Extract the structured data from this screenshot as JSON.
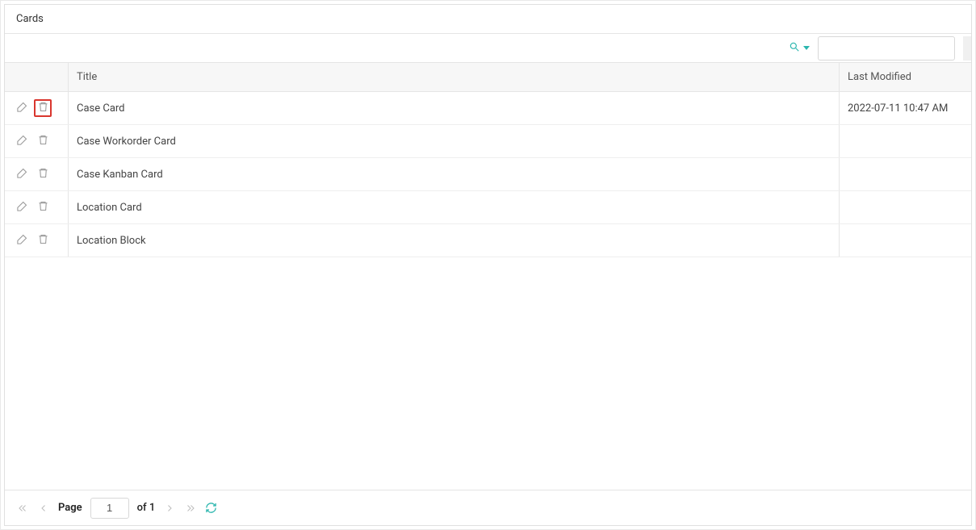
{
  "header": {
    "title": "Cards"
  },
  "toolbar": {
    "search_value": "",
    "search_placeholder": ""
  },
  "columns": {
    "title_label": "Title",
    "modified_label": "Last Modified"
  },
  "rows": [
    {
      "title": "Case Card",
      "modified": "2022-07-11 10:47 AM",
      "delete_highlight": true
    },
    {
      "title": "Case Workorder Card",
      "modified": "",
      "delete_highlight": false
    },
    {
      "title": "Case Kanban Card",
      "modified": "",
      "delete_highlight": false
    },
    {
      "title": "Location Card",
      "modified": "",
      "delete_highlight": false
    },
    {
      "title": "Location Block",
      "modified": "",
      "delete_highlight": false
    }
  ],
  "pager": {
    "page_label": "Page",
    "current": "1",
    "of_text": "of 1"
  }
}
